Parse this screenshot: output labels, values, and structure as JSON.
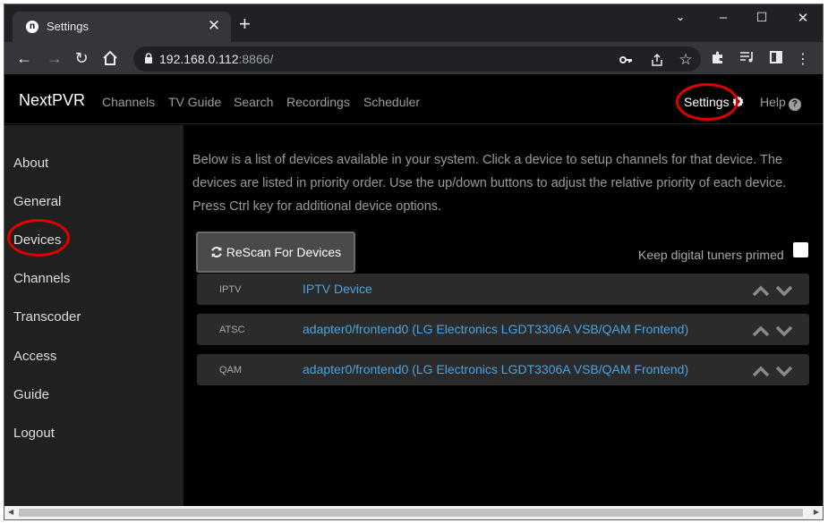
{
  "browser": {
    "tab_title": "Settings",
    "favicon_letter": "n",
    "url_host": "192.168.0.112",
    "url_port_path": ":8866/"
  },
  "app": {
    "brand": "NextPVR",
    "nav": [
      "Channels",
      "TV Guide",
      "Search",
      "Recordings",
      "Scheduler"
    ],
    "settings_label": "Settings",
    "help_label": "Help"
  },
  "sidebar": {
    "items": [
      "About",
      "General",
      "Devices",
      "Channels",
      "Transcoder",
      "Access",
      "Guide",
      "Logout"
    ]
  },
  "main": {
    "intro": "Below is a list of devices available in your system. Click a device to setup channels for that device. The devices are listed in priority order. Use the up/down buttons to adjust the relative priority of each device. Press Ctrl key for additional device options.",
    "rescan_label": "ReScan For Devices",
    "keep_primed_label": "Keep digital tuners primed",
    "devices": [
      {
        "type": "IPTV",
        "name": "IPTV Device"
      },
      {
        "type": "ATSC",
        "name": "adapter0/frontend0 (LG Electronics LGDT3306A VSB/QAM Frontend)"
      },
      {
        "type": "QAM",
        "name": "adapter0/frontend0 (LG Electronics LGDT3306A VSB/QAM Frontend)"
      }
    ]
  },
  "colors": {
    "annotation": "#e10000",
    "link": "#4aa3df"
  }
}
